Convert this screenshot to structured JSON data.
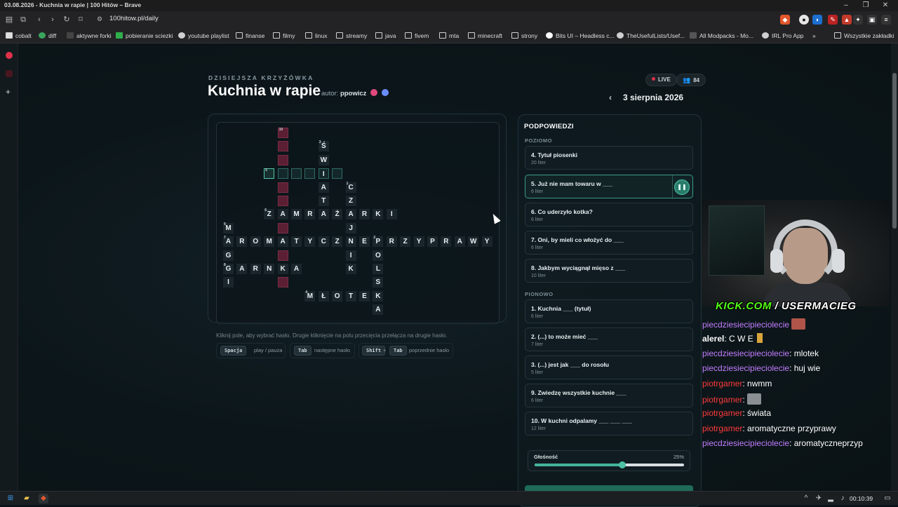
{
  "window": {
    "title": "03.08.2026 - Kuchnia w rapie | 100 Hitów – Brave",
    "minimize": "–",
    "maximize": "❐",
    "close": "✕"
  },
  "toolbar": {
    "url": "100hitow.pl/daily",
    "icons": [
      "sidebar-icon",
      "tabs-icon",
      "back-icon",
      "forward-icon",
      "reload-icon",
      "bookmark-icon",
      "site-settings-icon"
    ]
  },
  "bookmarks": [
    "cobalt",
    "diff",
    "aktywne forki",
    "pobieranie sciezki",
    "youtube playlist",
    "finanse",
    "filmy",
    "linux",
    "streamy",
    "java",
    "fivem",
    "mta",
    "minecraft",
    "strony",
    "Bits UI – Headless c...",
    "TheUsefulLists/Usef...",
    "All Modpacks - Mo...",
    "IRL Pro App",
    "»",
    "Wszystkie zakładki"
  ],
  "header": {
    "kicker": "DZISIEJSZA KRZYŻÓWKA",
    "title": "Kuchnia w rapie",
    "author_label": "autor:",
    "author_name": "ppowicz",
    "live_label": "LIVE",
    "viewers": "84",
    "date": "3 sierpnia 2026",
    "prev_icon": "‹"
  },
  "crossword": {
    "cells": [
      {
        "r": 0,
        "c": 4,
        "t": "",
        "k": "e",
        "n": "10"
      },
      {
        "r": 1,
        "c": 4,
        "t": "",
        "k": "e"
      },
      {
        "r": 1,
        "c": 7,
        "t": "Ś",
        "k": "l",
        "n": "3"
      },
      {
        "r": 2,
        "c": 4,
        "t": "",
        "k": "e"
      },
      {
        "r": 2,
        "c": 7,
        "t": "W",
        "k": "l"
      },
      {
        "r": 3,
        "c": 3,
        "t": "",
        "k": "s",
        "n": "5"
      },
      {
        "r": 3,
        "c": 4,
        "t": "",
        "k": "a"
      },
      {
        "r": 3,
        "c": 5,
        "t": "",
        "k": "a"
      },
      {
        "r": 3,
        "c": 6,
        "t": "",
        "k": "a"
      },
      {
        "r": 3,
        "c": 7,
        "t": "I",
        "k": "a"
      },
      {
        "r": 3,
        "c": 8,
        "t": "",
        "k": "a"
      },
      {
        "r": 4,
        "c": 4,
        "t": "",
        "k": "e"
      },
      {
        "r": 4,
        "c": 7,
        "t": "A",
        "k": "l"
      },
      {
        "r": 4,
        "c": 9,
        "t": "C",
        "k": "l",
        "n": "1"
      },
      {
        "r": 5,
        "c": 4,
        "t": "",
        "k": "e"
      },
      {
        "r": 5,
        "c": 7,
        "t": "T",
        "k": "l"
      },
      {
        "r": 5,
        "c": 9,
        "t": "Z",
        "k": "l"
      },
      {
        "r": 6,
        "c": 3,
        "t": "Z",
        "k": "l",
        "n": "6"
      },
      {
        "r": 6,
        "c": 4,
        "t": "A",
        "k": "l"
      },
      {
        "r": 6,
        "c": 5,
        "t": "M",
        "k": "l"
      },
      {
        "r": 6,
        "c": 6,
        "t": "R",
        "k": "l"
      },
      {
        "r": 6,
        "c": 7,
        "t": "A",
        "k": "l"
      },
      {
        "r": 6,
        "c": 8,
        "t": "Ż",
        "k": "l"
      },
      {
        "r": 6,
        "c": 9,
        "t": "A",
        "k": "l"
      },
      {
        "r": 6,
        "c": 10,
        "t": "R",
        "k": "l"
      },
      {
        "r": 6,
        "c": 11,
        "t": "K",
        "k": "l"
      },
      {
        "r": 6,
        "c": 12,
        "t": "I",
        "k": "l"
      },
      {
        "r": 7,
        "c": 0,
        "t": "M",
        "k": "l",
        "n": "9"
      },
      {
        "r": 7,
        "c": 4,
        "t": "",
        "k": "e"
      },
      {
        "r": 7,
        "c": 9,
        "t": "J",
        "k": "l"
      },
      {
        "r": 8,
        "c": 0,
        "t": "A",
        "k": "l",
        "n": "7"
      },
      {
        "r": 8,
        "c": 1,
        "t": "R",
        "k": "l"
      },
      {
        "r": 8,
        "c": 2,
        "t": "O",
        "k": "l"
      },
      {
        "r": 8,
        "c": 3,
        "t": "M",
        "k": "l"
      },
      {
        "r": 8,
        "c": 4,
        "t": "A",
        "k": "l"
      },
      {
        "r": 8,
        "c": 5,
        "t": "T",
        "k": "l"
      },
      {
        "r": 8,
        "c": 6,
        "t": "Y",
        "k": "l"
      },
      {
        "r": 8,
        "c": 7,
        "t": "C",
        "k": "l"
      },
      {
        "r": 8,
        "c": 8,
        "t": "Z",
        "k": "l"
      },
      {
        "r": 8,
        "c": 9,
        "t": "N",
        "k": "l"
      },
      {
        "r": 8,
        "c": 10,
        "t": "E",
        "k": "l"
      },
      {
        "r": 8,
        "c": 11,
        "t": "P",
        "k": "l",
        "n": "2"
      },
      {
        "r": 8,
        "c": 12,
        "t": "R",
        "k": "l"
      },
      {
        "r": 8,
        "c": 13,
        "t": "Z",
        "k": "l"
      },
      {
        "r": 8,
        "c": 14,
        "t": "Y",
        "k": "l"
      },
      {
        "r": 8,
        "c": 15,
        "t": "P",
        "k": "l"
      },
      {
        "r": 8,
        "c": 16,
        "t": "R",
        "k": "l"
      },
      {
        "r": 8,
        "c": 17,
        "t": "A",
        "k": "l"
      },
      {
        "r": 8,
        "c": 18,
        "t": "W",
        "k": "l"
      },
      {
        "r": 8,
        "c": 19,
        "t": "Y",
        "k": "l"
      },
      {
        "r": 9,
        "c": 0,
        "t": "G",
        "k": "l"
      },
      {
        "r": 9,
        "c": 4,
        "t": "",
        "k": "e"
      },
      {
        "r": 9,
        "c": 9,
        "t": "I",
        "k": "l"
      },
      {
        "r": 9,
        "c": 11,
        "t": "O",
        "k": "l"
      },
      {
        "r": 10,
        "c": 0,
        "t": "G",
        "k": "l",
        "n": "8"
      },
      {
        "r": 10,
        "c": 1,
        "t": "A",
        "k": "l"
      },
      {
        "r": 10,
        "c": 2,
        "t": "R",
        "k": "l"
      },
      {
        "r": 10,
        "c": 3,
        "t": "N",
        "k": "l"
      },
      {
        "r": 10,
        "c": 4,
        "t": "K",
        "k": "l"
      },
      {
        "r": 10,
        "c": 5,
        "t": "A",
        "k": "l"
      },
      {
        "r": 10,
        "c": 9,
        "t": "K",
        "k": "l"
      },
      {
        "r": 10,
        "c": 11,
        "t": "L",
        "k": "l"
      },
      {
        "r": 11,
        "c": 0,
        "t": "I",
        "k": "l"
      },
      {
        "r": 11,
        "c": 4,
        "t": "",
        "k": "e"
      },
      {
        "r": 11,
        "c": 11,
        "t": "S",
        "k": "l"
      },
      {
        "r": 12,
        "c": 6,
        "t": "M",
        "k": "l",
        "n": "4"
      },
      {
        "r": 12,
        "c": 7,
        "t": "Ł",
        "k": "l"
      },
      {
        "r": 12,
        "c": 8,
        "t": "O",
        "k": "l"
      },
      {
        "r": 12,
        "c": 9,
        "t": "T",
        "k": "l"
      },
      {
        "r": 12,
        "c": 10,
        "t": "E",
        "k": "l"
      },
      {
        "r": 12,
        "c": 11,
        "t": "K",
        "k": "l"
      },
      {
        "r": 13,
        "c": 11,
        "t": "A",
        "k": "l"
      }
    ]
  },
  "help": {
    "hint": "Kliknij pole, aby wybrać hasło. Drugie kliknięcie na polu przecięcia przełącza na drugie hasło.",
    "space_key": "Spacja",
    "space_label": "play / pauza",
    "tab_key": "Tab",
    "tab_label": "następne hasło",
    "shift_key": "Shift",
    "plus": "+",
    "tab_key2": "Tab",
    "shift_label": "poprzednie hasło"
  },
  "hints": {
    "title": "PODPOWIEDZI",
    "across_label": "POZIOMO",
    "down_label": "PIONOWO",
    "across": [
      {
        "text": "4. Tytuł piosenki",
        "len": "20 liter"
      },
      {
        "text": "5. Już nie mam towaru w ___",
        "len": "6 liter",
        "active": true
      },
      {
        "text": "6. Co uderzyło kotka?",
        "len": "6 liter"
      },
      {
        "text": "7. Oni, by mieli co włożyć do ___",
        "len": "6 liter"
      },
      {
        "text": "8. Jakbym wyciągnął mięso z ___",
        "len": "10 liter"
      }
    ],
    "down": [
      {
        "text": "1. Kuchnia ___ (tytuł)",
        "len": "6 liter"
      },
      {
        "text": "2. (...) to może mieć ___",
        "len": "7 liter"
      },
      {
        "text": "3. (...) jest jak ___ do rosołu",
        "len": "5 liter"
      },
      {
        "text": "9. Zwiedzę wszystkie kuchnie ___",
        "len": "6 liter"
      },
      {
        "text": "10. W kuchni odpalamy ___ ___ ___",
        "len": "12 liter"
      }
    ],
    "pause_icon": "❚❚",
    "volume_label": "Głośność",
    "volume_value": "25%",
    "volume_level": 0.25
  },
  "stream": {
    "kick_prefix": "KICK.COM",
    "kick_sep": " / ",
    "kick_user": "USERMACIEG",
    "chat": [
      {
        "user": "piecdziesiecipiecioleci",
        "user_tail": "e",
        "msg": "",
        "emote": true,
        "cls": "u1"
      },
      {
        "user": "alerel",
        "user_tail": "",
        "msg": ": C  W  E",
        "emote": false,
        "cls": "u3"
      },
      {
        "user": "piecdziesiecipiecioleci",
        "user_tail": "e",
        "msg": ": mlotek",
        "emote": false,
        "cls": "u1"
      },
      {
        "user": "piecdziesiecipiecioleci",
        "user_tail": "e",
        "msg": ": huj wie",
        "emote": false,
        "cls": "u1"
      },
      {
        "user": "piotrgamer",
        "user_tail": "",
        "msg": ": nwmm",
        "emote": false,
        "cls": "u2"
      },
      {
        "user": "piotrgamer",
        "user_tail": "",
        "msg": ":",
        "emote": true,
        "cls": "u2"
      },
      {
        "user": "piotrgamer",
        "user_tail": "",
        "msg": ": świata",
        "emote": false,
        "cls": "u2"
      },
      {
        "user": "piotrgamer",
        "user_tail": "",
        "msg": ": aromatyczne przyprawy",
        "emote": false,
        "cls": "u2"
      },
      {
        "user": "piecdziesiecipiecioleci",
        "user_tail": "e",
        "msg": ": aromatyczneprzyp",
        "emote": false,
        "cls": "u1"
      }
    ]
  },
  "taskbar": {
    "time": "00:10:39"
  },
  "colors": {
    "accent": "#4fc7a8",
    "empty_cell": "#5b1f33",
    "live_dot": "#e0314a",
    "kick_green": "#53fc18"
  }
}
